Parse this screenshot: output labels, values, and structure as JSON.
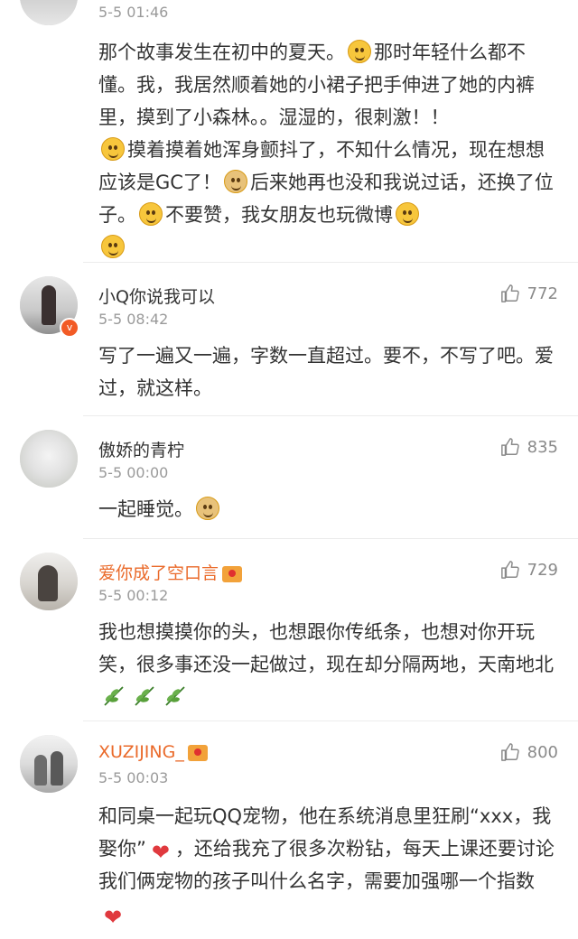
{
  "top_comment": {
    "time": "5-5 01:46",
    "body_parts": [
      "那个故事发生在初中的夏天。",
      "那时年轻什么都不懂。我，我居然顺着她的小裙子把手伸进了她的内裤里，摸到了小森林。。湿湿的，很刺激！！",
      "摸着摸着她浑身颤抖了，不知什么情况，现在想想应该是GC了！",
      "后来她再也没和我说过话，还换了位子。",
      "不要赞，我女朋友也玩微博"
    ]
  },
  "comments": [
    {
      "username": "小Q你说我可以",
      "verified": true,
      "time": "5-5 08:42",
      "likes": "772",
      "body": "写了一遍又一遍，字数一直超过。要不，不写了吧。爱过，就这样。"
    },
    {
      "username": "傲娇的青柠",
      "time": "5-5 00:00",
      "likes": "835",
      "body": "一起睡觉。"
    },
    {
      "username": "爱你成了空口言",
      "vip": true,
      "time": "5-5 00:12",
      "likes": "729",
      "body": "我也想摸摸你的头，也想跟你传纸条，也想对你开玩笑，很多事还没一起做过，现在却分隔两地，天南地北"
    },
    {
      "username": "XUZIJING_",
      "vip": true,
      "time": "5-5 00:03",
      "likes": "800",
      "body_parts": [
        "和同桌一起玩QQ宠物，他在系统消息里狂刷“xxx，我娶你”",
        "，还给我充了很多次粉钻，每天上课还要讨论我们俩宠物的孩子叫什么名字，需要加强哪一个指数"
      ]
    }
  ],
  "icons": {
    "like": "thumbs-up-icon",
    "verified": "verified-v-icon",
    "vip": "vip-crown-icon"
  },
  "colors": {
    "vip_name": "#ea6a2a",
    "text": "#333333",
    "meta": "#9a9a9a",
    "verified_badge": "#f25b26"
  }
}
